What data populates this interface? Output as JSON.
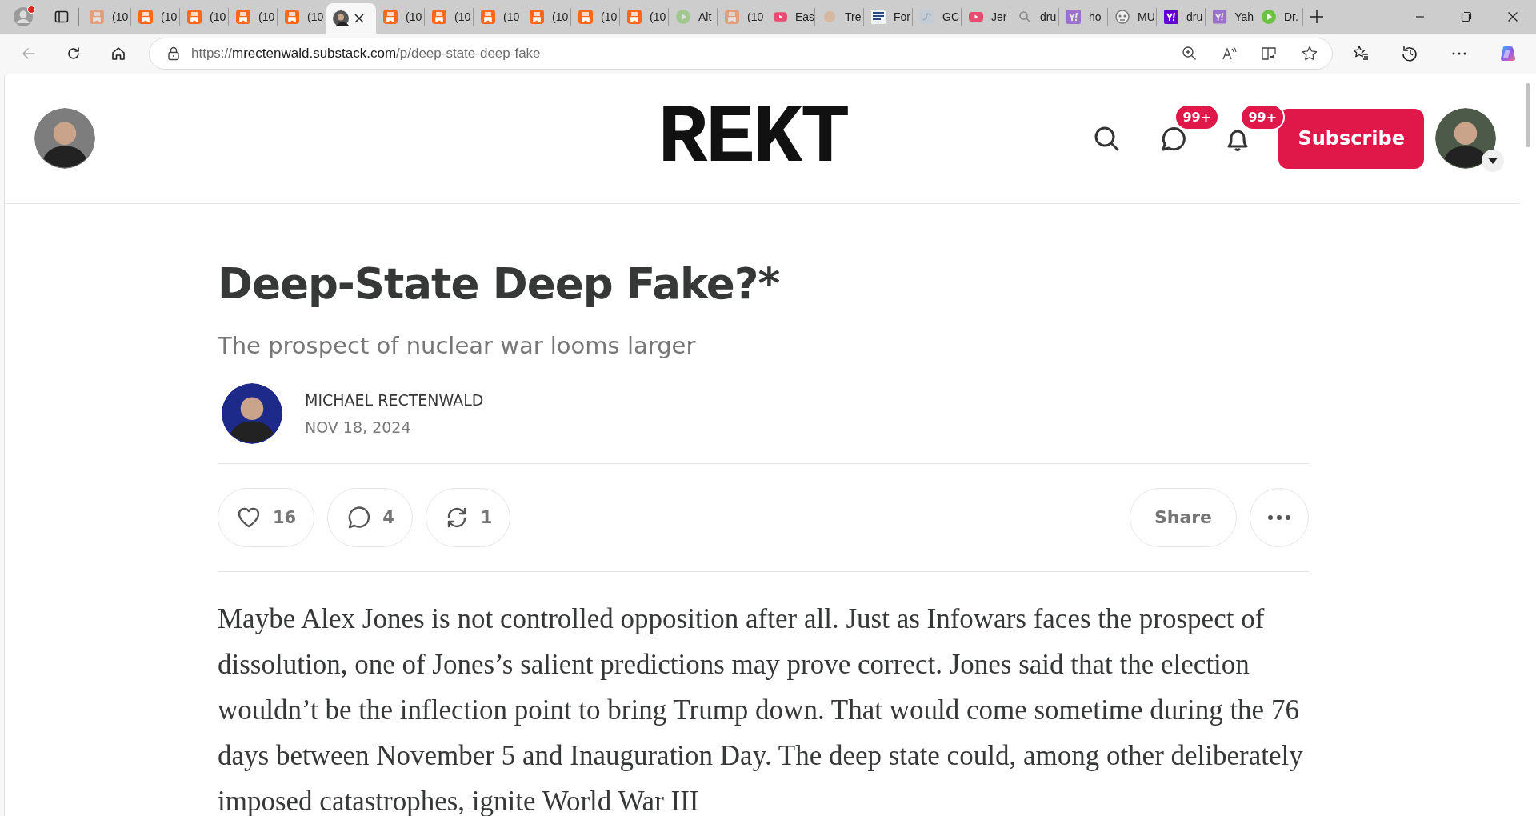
{
  "browser": {
    "tabs": [
      {
        "kind": "substack",
        "label": "(10",
        "selected": false,
        "sleeping": true
      },
      {
        "kind": "substack",
        "label": "(10",
        "selected": false,
        "sleeping": false
      },
      {
        "kind": "substack",
        "label": "(10",
        "selected": false,
        "sleeping": false
      },
      {
        "kind": "substack",
        "label": "(10",
        "selected": false,
        "sleeping": false
      },
      {
        "kind": "substack",
        "label": "(10",
        "selected": false,
        "sleeping": false
      },
      {
        "kind": "avatar",
        "selected": true,
        "sleeping": false
      },
      {
        "kind": "substack",
        "label": "(10",
        "selected": false,
        "sleeping": false
      },
      {
        "kind": "substack",
        "label": "(10",
        "selected": false,
        "sleeping": false
      },
      {
        "kind": "substack",
        "label": "(10",
        "selected": false,
        "sleeping": false
      },
      {
        "kind": "substack",
        "label": "(10",
        "selected": false,
        "sleeping": false
      },
      {
        "kind": "substack",
        "label": "(10",
        "selected": false,
        "sleeping": false
      },
      {
        "kind": "substack",
        "label": "(10",
        "selected": false,
        "sleeping": false
      },
      {
        "kind": "play",
        "label": "Alt",
        "selected": false,
        "sleeping": true
      },
      {
        "kind": "substack",
        "label": "(10",
        "selected": false,
        "sleeping": true
      },
      {
        "kind": "youtube",
        "label": "Eas",
        "selected": false,
        "sleeping": false
      },
      {
        "kind": "dot",
        "label": "Tre",
        "selected": false,
        "sleeping": true
      },
      {
        "kind": "news",
        "label": "For",
        "selected": false,
        "sleeping": false
      },
      {
        "kind": "bird",
        "label": "GC",
        "selected": false,
        "sleeping": true
      },
      {
        "kind": "youtube",
        "label": "Jer",
        "selected": false,
        "sleeping": false
      },
      {
        "kind": "search",
        "label": "dru",
        "selected": false,
        "sleeping": false
      },
      {
        "kind": "yahoo",
        "label": "ho",
        "selected": false,
        "sleeping": true
      },
      {
        "kind": "mask",
        "label": "MU",
        "selected": false,
        "sleeping": false
      },
      {
        "kind": "yahoo",
        "label": "dru",
        "selected": false,
        "sleeping": false
      },
      {
        "kind": "yahoo",
        "label": "Yah",
        "selected": false,
        "sleeping": true
      },
      {
        "kind": "play",
        "label": "Dr.",
        "selected": false,
        "sleeping": false
      }
    ],
    "nav": [
      {
        "kind": "back",
        "disabled": true
      },
      {
        "kind": "reload",
        "disabled": false
      },
      {
        "kind": "home",
        "disabled": false
      }
    ],
    "address": {
      "scheme": "https://",
      "host": "mrectenwald.substack.com",
      "path": "/p/deep-state-deep-fake"
    }
  },
  "header": {
    "logo": "REKT",
    "messages_badge": "99+",
    "notifications_badge": "99+",
    "subscribe": "Subscribe"
  },
  "post": {
    "title": "Deep-State Deep Fake?*",
    "subtitle": "The prospect of nuclear war looms larger",
    "author": "MICHAEL RECTENWALD",
    "date": "NOV 18, 2024",
    "actions": [
      {
        "kind": "like",
        "count": "16"
      },
      {
        "kind": "comment",
        "count": "4"
      },
      {
        "kind": "restack",
        "count": "1"
      }
    ],
    "share": "Share",
    "body": "Maybe Alex Jones is not controlled opposition after all. Just as Infowars faces the prospect of dissolution, one of Jones’s salient predictions may prove correct. Jones said that the election wouldn’t be the inflection point to bring Trump down. That would come sometime during the 76 days between November 5 and Inauguration Day. The deep state could, among other deliberately imposed catastrophes, ignite World War III"
  }
}
